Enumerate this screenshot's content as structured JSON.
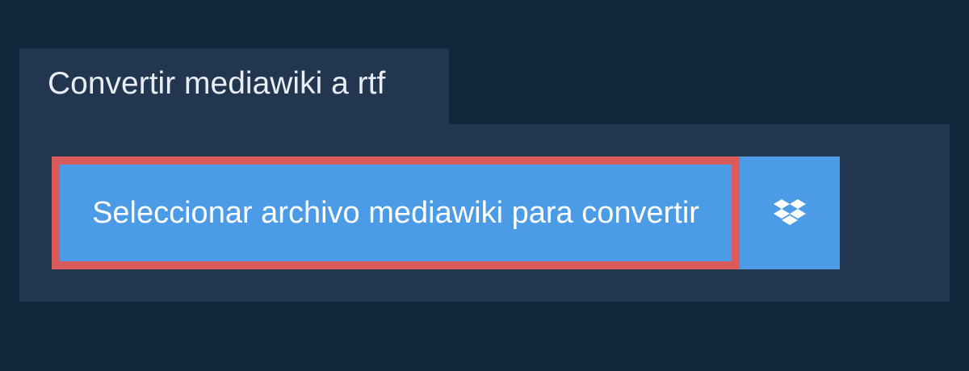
{
  "header": {
    "title": "Convertir mediawiki a rtf"
  },
  "upload": {
    "select_label": "Seleccionar archivo mediawiki para convertir",
    "dropbox_icon": "dropbox-icon"
  },
  "colors": {
    "page_background": "#12263c",
    "panel_background": "#22364f",
    "button_blue": "#4c9be7",
    "highlight_border": "#d95b5b",
    "title_text": "#e8edf3"
  }
}
